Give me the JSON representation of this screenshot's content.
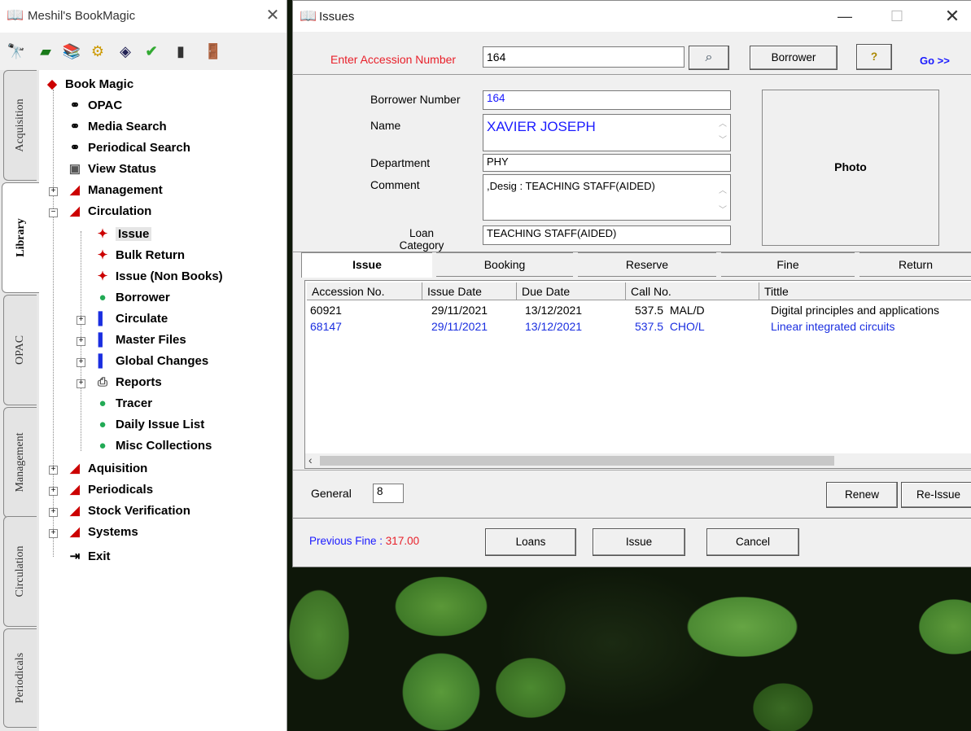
{
  "left_window": {
    "title": "Meshil's BookMagic",
    "side_tabs": [
      "Acquisition",
      "Library",
      "OPAC",
      "Management",
      "Circulation",
      "Periodicals"
    ],
    "tree": {
      "root": "Book Magic",
      "opac": "OPAC",
      "media_search": "Media Search",
      "periodical_search": "Periodical Search",
      "view_status": "View Status",
      "management": "Management",
      "circulation": "Circulation",
      "issue": "Issue",
      "bulk_return": "Bulk Return",
      "issue_non_books": "Issue (Non Books)",
      "borrower": "Borrower",
      "circulate": "Circulate",
      "master_files": "Master Files",
      "global_changes": "Global Changes",
      "reports": "Reports",
      "tracer": "Tracer",
      "daily_issue_list": "Daily Issue List",
      "misc_collections": "Misc Collections",
      "aquisition": "Aquisition",
      "periodicals": "Periodicals",
      "stock_verification": "Stock Verification",
      "systems": "Systems",
      "exit": "Exit"
    }
  },
  "issues_window": {
    "title": "Issues",
    "accession_label": "Enter Accession Number",
    "accession_value": "164",
    "borrower_button": "Borrower",
    "help_icon": "?",
    "go_link": "Go >>",
    "borrower_number_label": "Borrower Number",
    "borrower_number": "164",
    "name_label": "Name",
    "name": "XAVIER JOSEPH",
    "department_label": "Department",
    "department": "PHY",
    "comment_label": "Comment",
    "comment": ",Desig : TEACHING STAFF(AIDED)",
    "loan_category_label": "Loan Category",
    "loan_category": "TEACHING STAFF(AIDED)",
    "photo_label": "Photo",
    "tabs": [
      "Issue",
      "Booking",
      "Reserve",
      "Fine",
      "Return"
    ],
    "grid_headers": [
      "Accession No.",
      "Issue Date",
      "Due Date",
      "Call No.",
      "Tittle"
    ],
    "rows": [
      {
        "acc": "60921",
        "issue": "29/11/2021",
        "due": "13/12/2021",
        "call": "537.5  MAL/D",
        "title": "Digital principles and applications"
      },
      {
        "acc": "68147",
        "issue": "29/11/2021",
        "due": "13/12/2021",
        "call": "537.5  CHO/L",
        "title": "Linear integrated circuits"
      }
    ],
    "general_label": "General",
    "general_value": "8",
    "renew_button": "Renew",
    "reissue_button": "Re-Issue",
    "previous_fine_label": "Previous Fine : ",
    "previous_fine_value": "317.00",
    "loans_button": "Loans",
    "issue_button": "Issue",
    "cancel_button": "Cancel"
  },
  "colors": {
    "accent_red": "#e8202a",
    "link_blue": "#1a1aff",
    "row_blue": "#1a2ee0"
  }
}
